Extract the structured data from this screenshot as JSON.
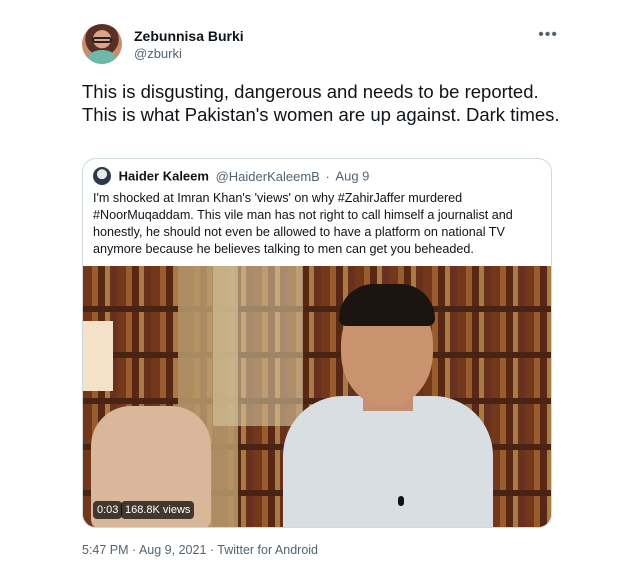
{
  "author": {
    "name": "Zebunnisa Burki",
    "handle": "@zburki"
  },
  "more_icon": "•••",
  "tweet": {
    "text": "This is disgusting, dangerous and needs to be reported. This is what Pakistan's women are up against. Dark times."
  },
  "quote": {
    "name": "Haider Kaleem",
    "handle": "@HaiderKaleemB",
    "separator": "·",
    "date": "Aug 9",
    "text": "I'm shocked at Imran Khan's 'views' on why #ZahirJaffer murdered #NoorMuqaddam. This vile man has not right to call himself a journalist and honestly, he should not even be allowed to have a platform on national TV anymore because he believes talking to men can get you beheaded.",
    "video": {
      "time": "0:03",
      "views": "168.8K views"
    }
  },
  "meta": "5:47 PM · Aug 9, 2021 · Twitter for Android"
}
